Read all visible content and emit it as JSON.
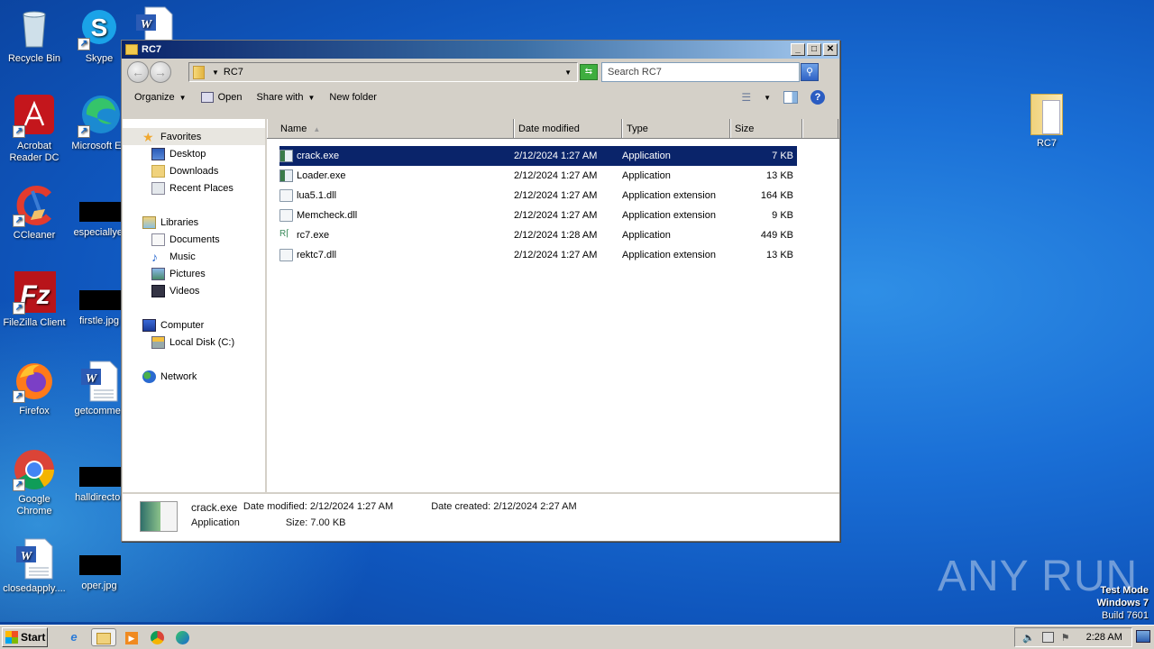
{
  "desktop": {
    "icons": [
      {
        "label": "Recycle Bin",
        "icon": "recycle-bin-icon"
      },
      {
        "label": "Skype",
        "icon": "skype-icon"
      },
      {
        "label": "Acrobat Reader DC",
        "icon": "acrobat-icon"
      },
      {
        "label": "Microsoft Ed",
        "icon": "edge-icon"
      },
      {
        "label": "CCleaner",
        "icon": "ccleaner-icon"
      },
      {
        "label": "especiallyel",
        "icon": "redacted-thumbnail"
      },
      {
        "label": "FileZilla Client",
        "icon": "filezilla-icon"
      },
      {
        "label": "firstle.jpg",
        "icon": "redacted-thumbnail"
      },
      {
        "label": "Firefox",
        "icon": "firefox-icon"
      },
      {
        "label": "getcommer",
        "icon": "word-doc-icon"
      },
      {
        "label": "Google Chrome",
        "icon": "chrome-icon"
      },
      {
        "label": "halldirector",
        "icon": "redacted-thumbnail"
      },
      {
        "label": "closedapply....",
        "icon": "word-doc-icon"
      },
      {
        "label": "oper.jpg",
        "icon": "redacted-thumbnail"
      },
      {
        "label": "RC7",
        "icon": "folder-icon"
      }
    ],
    "watermark": "ANY RUN",
    "test_mode": [
      "Test Mode",
      "Windows 7",
      "Build 7601"
    ]
  },
  "window": {
    "title": "RC7",
    "controls": {
      "minimize": "_",
      "maximize": "□",
      "close": "✕"
    },
    "address": {
      "path": "RC7"
    },
    "search": {
      "placeholder": "Search RC7"
    },
    "toolbar": {
      "organize": "Organize",
      "open": "Open",
      "share_with": "Share with",
      "new_folder": "New folder"
    },
    "sidebar": {
      "groups": [
        {
          "label": "Favorites",
          "items": [
            "Desktop",
            "Downloads",
            "Recent Places"
          ]
        },
        {
          "label": "Libraries",
          "items": [
            "Documents",
            "Music",
            "Pictures",
            "Videos"
          ]
        },
        {
          "label": "Computer",
          "items": [
            "Local Disk (C:)"
          ]
        },
        {
          "label": "Network",
          "items": []
        }
      ]
    },
    "columns": [
      "Name",
      "Date modified",
      "Type",
      "Size"
    ],
    "files": [
      {
        "name": "crack.exe",
        "date": "2/12/2024 1:27 AM",
        "type": "Application",
        "size": "7 KB",
        "kind": "exe",
        "selected": true
      },
      {
        "name": "Loader.exe",
        "date": "2/12/2024 1:27 AM",
        "type": "Application",
        "size": "13 KB",
        "kind": "exe",
        "selected": false
      },
      {
        "name": "lua5.1.dll",
        "date": "2/12/2024 1:27 AM",
        "type": "Application extension",
        "size": "164 KB",
        "kind": "dll",
        "selected": false
      },
      {
        "name": "Memcheck.dll",
        "date": "2/12/2024 1:27 AM",
        "type": "Application extension",
        "size": "9 KB",
        "kind": "dll",
        "selected": false
      },
      {
        "name": "rc7.exe",
        "date": "2/12/2024 1:28 AM",
        "type": "Application",
        "size": "449 KB",
        "kind": "rc",
        "selected": false
      },
      {
        "name": "rektc7.dll",
        "date": "2/12/2024 1:27 AM",
        "type": "Application extension",
        "size": "13 KB",
        "kind": "dll",
        "selected": false
      }
    ],
    "details": {
      "name": "crack.exe",
      "type": "Application",
      "modified_label": "Date modified:",
      "modified": "2/12/2024 1:27 AM",
      "created_label": "Date created:",
      "created": "2/12/2024 2:27 AM",
      "size_label": "Size:",
      "size": "7.00 KB"
    }
  },
  "taskbar": {
    "start": "Start",
    "clock": "2:28 AM"
  }
}
